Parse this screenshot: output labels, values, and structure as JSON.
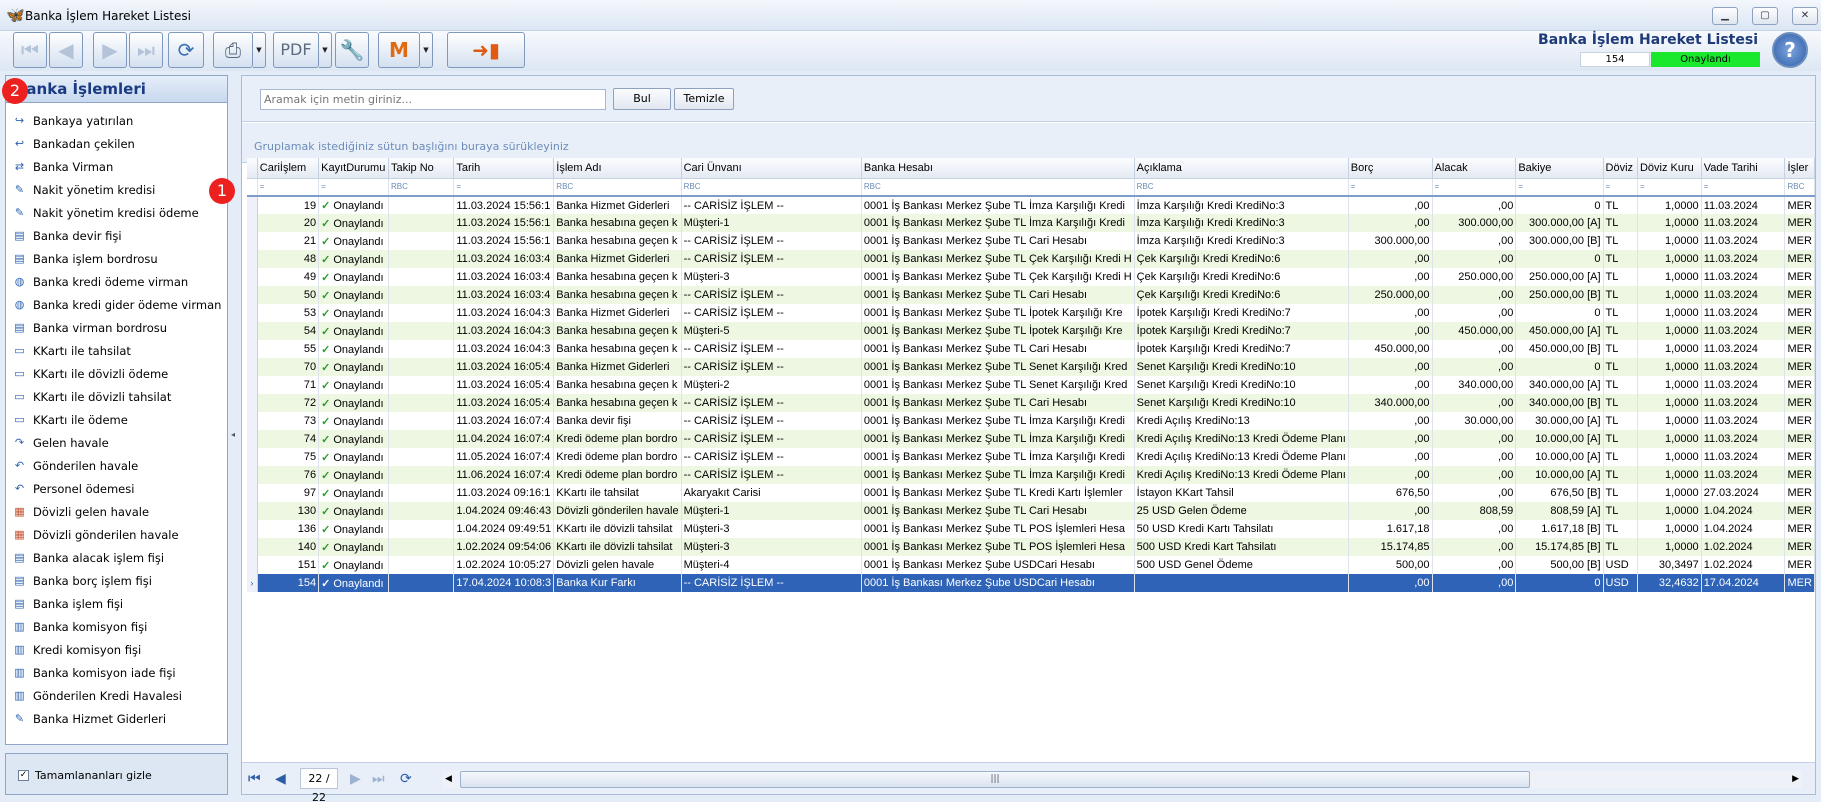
{
  "window": {
    "title": "Banka İşlem Hareket Listesi"
  },
  "header": {
    "title": "Banka İşlem Hareket Listesi",
    "count": "154",
    "status": "Onaylandı",
    "status_color": "#19e82d"
  },
  "toolbar": {
    "buttons": [
      "first-record",
      "previous-record",
      "next-record",
      "last-record",
      "refresh",
      "print",
      "export-pdf",
      "tools",
      "m-module",
      "exit"
    ],
    "help": "?"
  },
  "sidebar": {
    "title": "Banka İşlemleri",
    "items": [
      {
        "label": "Bankaya yatırılan",
        "icon": "deposit-icon"
      },
      {
        "label": "Bankadan çekilen",
        "icon": "withdraw-icon"
      },
      {
        "label": "Banka Virman",
        "icon": "transfer-icon"
      },
      {
        "label": "Nakit yönetim kredisi",
        "icon": "credit-icon"
      },
      {
        "label": "Nakit yönetim kredisi ödeme",
        "icon": "credit-payment-icon"
      },
      {
        "label": "Banka devir fişi",
        "icon": "document-icon"
      },
      {
        "label": "Banka işlem bordrosu",
        "icon": "document-icon"
      },
      {
        "label": "Banka kredi ödeme virman",
        "icon": "globe-icon"
      },
      {
        "label": "Banka kredi gider ödeme virman",
        "icon": "globe-icon"
      },
      {
        "label": "Banka virman bordrosu",
        "icon": "document-icon"
      },
      {
        "label": "KKartı ile tahsilat",
        "icon": "card-icon"
      },
      {
        "label": "KKartı ile dövizli ödeme",
        "icon": "card-icon"
      },
      {
        "label": "KKartı ile dövizli tahsilat",
        "icon": "card-icon"
      },
      {
        "label": "KKartı ile ödeme",
        "icon": "card-icon"
      },
      {
        "label": "Gelen havale",
        "icon": "incoming-icon"
      },
      {
        "label": "Gönderilen havale",
        "icon": "outgoing-icon"
      },
      {
        "label": "Personel ödemesi",
        "icon": "outgoing-icon"
      },
      {
        "label": "Dövizli gelen havale",
        "icon": "grid-icon"
      },
      {
        "label": "Dövizli gönderilen havale",
        "icon": "grid-icon"
      },
      {
        "label": "Banka alacak işlem fişi",
        "icon": "document-icon"
      },
      {
        "label": "Banka borç işlem fişi",
        "icon": "document-icon"
      },
      {
        "label": "Banka işlem fişi",
        "icon": "document-icon"
      },
      {
        "label": "Banka komisyon fişi",
        "icon": "commission-icon"
      },
      {
        "label": "Kredi komisyon fişi",
        "icon": "commission-icon"
      },
      {
        "label": "Banka komisyon iade fişi",
        "icon": "commission-icon"
      },
      {
        "label": "Gönderilen Kredi Havalesi",
        "icon": "commission-icon"
      },
      {
        "label": "Banka Hizmet Giderleri",
        "icon": "expense-icon"
      }
    ],
    "footer_checkbox": {
      "label": "Tamamlananları gizle",
      "checked": true
    }
  },
  "search": {
    "placeholder": "Aramak için metin giriniz...",
    "find_label": "Bul",
    "clear_label": "Temizle"
  },
  "group_hint": "Gruplamak istediğiniz sütun başlığını buraya sürükleyiniz",
  "badges": {
    "one": "1",
    "two": "2"
  },
  "grid": {
    "columns": [
      "Cariİşlem",
      "KayıtDurumu",
      "Takip No",
      "Tarih",
      "İşlem Adı",
      "Cari Ünvanı",
      "Banka Hesabı",
      "Açıklama",
      "Borç",
      "Alacak",
      "Bakiye",
      "Döviz",
      "Döviz Kuru",
      "Vade Tarihi",
      "İşler"
    ],
    "filter_row": [
      "=",
      "=",
      "RBC",
      "=",
      "RBC",
      "RBC",
      "RBC",
      "RBC",
      "=",
      "=",
      "=",
      "=",
      "=",
      "=",
      "RBC"
    ],
    "rows": [
      [
        "19",
        "Onaylandı",
        "",
        "11.03.2024 15:56:1",
        "Banka Hizmet Giderleri",
        "-- CARİSİZ İŞLEM --",
        "0001 İş Bankası Merkez Şube TL İmza Karşılığı Kredi",
        "İmza Karşılığı Kredi KrediNo:3",
        ",00",
        ",00",
        "0",
        "TL",
        "1,0000",
        "11.03.2024",
        "MER"
      ],
      [
        "20",
        "Onaylandı",
        "",
        "11.03.2024 15:56:1",
        "Banka hesabına geçen k",
        "Müşteri-1",
        "0001 İş Bankası Merkez Şube TL İmza Karşılığı Kredi",
        "İmza Karşılığı Kredi KrediNo:3",
        ",00",
        "300.000,00",
        "300.000,00 [A]",
        "TL",
        "1,0000",
        "11.03.2024",
        "MER"
      ],
      [
        "21",
        "Onaylandı",
        "",
        "11.03.2024 15:56:1",
        "Banka hesabına geçen k",
        "-- CARİSİZ İŞLEM --",
        "0001 İş Bankası Merkez Şube TL Cari Hesabı",
        "İmza Karşılığı Kredi KrediNo:3",
        "300.000,00",
        ",00",
        "300.000,00 [B]",
        "TL",
        "1,0000",
        "11.03.2024",
        "MER"
      ],
      [
        "48",
        "Onaylandı",
        "",
        "11.03.2024 16:03:4",
        "Banka Hizmet Giderleri",
        "-- CARİSİZ İŞLEM --",
        "0001 İş Bankası Merkez Şube TL Çek Karşılığı Kredi H",
        "Çek Karşılığı Kredi KrediNo:6",
        ",00",
        ",00",
        "0",
        "TL",
        "1,0000",
        "11.03.2024",
        "MER"
      ],
      [
        "49",
        "Onaylandı",
        "",
        "11.03.2024 16:03:4",
        "Banka hesabına geçen k",
        "Müşteri-3",
        "0001 İş Bankası Merkez Şube TL Çek Karşılığı Kredi H",
        "Çek Karşılığı Kredi KrediNo:6",
        ",00",
        "250.000,00",
        "250.000,00 [A]",
        "TL",
        "1,0000",
        "11.03.2024",
        "MER"
      ],
      [
        "50",
        "Onaylandı",
        "",
        "11.03.2024 16:03:4",
        "Banka hesabına geçen k",
        "-- CARİSİZ İŞLEM --",
        "0001 İş Bankası Merkez Şube TL Cari Hesabı",
        "Çek Karşılığı Kredi KrediNo:6",
        "250.000,00",
        ",00",
        "250.000,00 [B]",
        "TL",
        "1,0000",
        "11.03.2024",
        "MER"
      ],
      [
        "53",
        "Onaylandı",
        "",
        "11.03.2024 16:04:3",
        "Banka Hizmet Giderleri",
        "-- CARİSİZ İŞLEM --",
        "0001 İş Bankası Merkez Şube TL İpotek Karşılığı Kre",
        "İpotek Karşılığı Kredi KrediNo:7",
        ",00",
        ",00",
        "0",
        "TL",
        "1,0000",
        "11.03.2024",
        "MER"
      ],
      [
        "54",
        "Onaylandı",
        "",
        "11.03.2024 16:04:3",
        "Banka hesabına geçen k",
        "Müşteri-5",
        "0001 İş Bankası Merkez Şube TL İpotek Karşılığı Kre",
        "İpotek Karşılığı Kredi KrediNo:7",
        ",00",
        "450.000,00",
        "450.000,00 [A]",
        "TL",
        "1,0000",
        "11.03.2024",
        "MER"
      ],
      [
        "55",
        "Onaylandı",
        "",
        "11.03.2024 16:04:3",
        "Banka hesabına geçen k",
        "-- CARİSİZ İŞLEM --",
        "0001 İş Bankası Merkez Şube TL Cari Hesabı",
        "İpotek Karşılığı Kredi KrediNo:7",
        "450.000,00",
        ",00",
        "450.000,00 [B]",
        "TL",
        "1,0000",
        "11.03.2024",
        "MER"
      ],
      [
        "70",
        "Onaylandı",
        "",
        "11.03.2024 16:05:4",
        "Banka Hizmet Giderleri",
        "-- CARİSİZ İŞLEM --",
        "0001 İş Bankası Merkez Şube TL Senet Karşılığı Kred",
        "Senet Karşılığı Kredi KrediNo:10",
        ",00",
        ",00",
        "0",
        "TL",
        "1,0000",
        "11.03.2024",
        "MER"
      ],
      [
        "71",
        "Onaylandı",
        "",
        "11.03.2024 16:05:4",
        "Banka hesabına geçen k",
        "Müşteri-2",
        "0001 İş Bankası Merkez Şube TL Senet Karşılığı Kred",
        "Senet Karşılığı Kredi KrediNo:10",
        ",00",
        "340.000,00",
        "340.000,00 [A]",
        "TL",
        "1,0000",
        "11.03.2024",
        "MER"
      ],
      [
        "72",
        "Onaylandı",
        "",
        "11.03.2024 16:05:4",
        "Banka hesabına geçen k",
        "-- CARİSİZ İŞLEM --",
        "0001 İş Bankası Merkez Şube TL Cari Hesabı",
        "Senet Karşılığı Kredi KrediNo:10",
        "340.000,00",
        ",00",
        "340.000,00 [B]",
        "TL",
        "1,0000",
        "11.03.2024",
        "MER"
      ],
      [
        "73",
        "Onaylandı",
        "",
        "11.03.2024 16:07:4",
        "Banka devir fişi",
        "-- CARİSİZ İŞLEM --",
        "0001 İş Bankası Merkez Şube TL İmza Karşılığı Kredi",
        "Kredi Açılış KrediNo:13",
        ",00",
        "30.000,00",
        "30.000,00 [A]",
        "TL",
        "1,0000",
        "11.03.2024",
        "MER"
      ],
      [
        "74",
        "Onaylandı",
        "",
        "11.04.2024 16:07:4",
        "Kredi ödeme plan bordro",
        "-- CARİSİZ İŞLEM --",
        "0001 İş Bankası Merkez Şube TL İmza Karşılığı Kredi",
        "Kredi Açılış KrediNo:13 Kredi Ödeme Planı",
        ",00",
        ",00",
        "10.000,00 [A]",
        "TL",
        "1,0000",
        "11.03.2024",
        "MER"
      ],
      [
        "75",
        "Onaylandı",
        "",
        "11.05.2024 16:07:4",
        "Kredi ödeme plan bordro",
        "-- CARİSİZ İŞLEM --",
        "0001 İş Bankası Merkez Şube TL İmza Karşılığı Kredi",
        "Kredi Açılış KrediNo:13 Kredi Ödeme Planı",
        ",00",
        ",00",
        "10.000,00 [A]",
        "TL",
        "1,0000",
        "11.03.2024",
        "MER"
      ],
      [
        "76",
        "Onaylandı",
        "",
        "11.06.2024 16:07:4",
        "Kredi ödeme plan bordro",
        "-- CARİSİZ İŞLEM --",
        "0001 İş Bankası Merkez Şube TL İmza Karşılığı Kredi",
        "Kredi Açılış KrediNo:13 Kredi Ödeme Planı",
        ",00",
        ",00",
        "10.000,00 [A]",
        "TL",
        "1,0000",
        "11.03.2024",
        "MER"
      ],
      [
        "97",
        "Onaylandı",
        "",
        "11.03.2024 09:16:1",
        "KKartı ile tahsilat",
        "Akaryakıt Carisi",
        "0001 İş Bankası Merkez Şube TL Kredi Kartı İşlemler",
        "İstayon KKart Tahsil",
        "676,50",
        ",00",
        "676,50 [B]",
        "TL",
        "1,0000",
        "27.03.2024",
        "MER"
      ],
      [
        "130",
        "Onaylandı",
        "",
        "1.04.2024 09:46:43",
        "Dövizli gönderilen havale",
        "Müşteri-1",
        "0001 İş Bankası Merkez Şube TL Cari Hesabı",
        "25 USD Gelen Ödeme",
        ",00",
        "808,59",
        "808,59 [A]",
        "TL",
        "1,0000",
        "1.04.2024",
        "MER"
      ],
      [
        "136",
        "Onaylandı",
        "",
        "1.04.2024 09:49:51",
        "KKartı ile dövizli tahsilat",
        "Müşteri-3",
        "0001 İş Bankası Merkez Şube TL POS İşlemleri Hesa",
        "50 USD Kredi Kartı Tahsilatı",
        "1.617,18",
        ",00",
        "1.617,18 [B]",
        "TL",
        "1,0000",
        "1.04.2024",
        "MER"
      ],
      [
        "140",
        "Onaylandı",
        "",
        "1.02.2024 09:54:06",
        "KKartı ile dövizli tahsilat",
        "Müşteri-3",
        "0001 İş Bankası Merkez Şube TL POS İşlemleri Hesa",
        "500 USD Kredi Kart Tahsilatı",
        "15.174,85",
        ",00",
        "15.174,85 [B]",
        "TL",
        "1,0000",
        "1.02.2024",
        "MER"
      ],
      [
        "151",
        "Onaylandı",
        "",
        "1.02.2024 10:05:27",
        "Dövizli gelen havale",
        "Müşteri-4",
        "0001 İş Bankası Merkez Şube USDCari Hesabı",
        "500 USD Genel Ödeme",
        "500,00",
        ",00",
        "500,00 [B]",
        "USD",
        "30,3497",
        "1.02.2024",
        "MER"
      ],
      [
        "154",
        "Onaylandı",
        "",
        "17.04.2024 10:08:3",
        "Banka Kur Farkı",
        "-- CARİSİZ İŞLEM --",
        "0001 İş Bankası Merkez Şube USDCari Hesabı",
        "",
        ",00",
        ",00",
        "0",
        "USD",
        "32,4632",
        "17.04.2024",
        "MER"
      ]
    ],
    "selected_row": 21
  },
  "pager": {
    "page": "22 / 22"
  }
}
